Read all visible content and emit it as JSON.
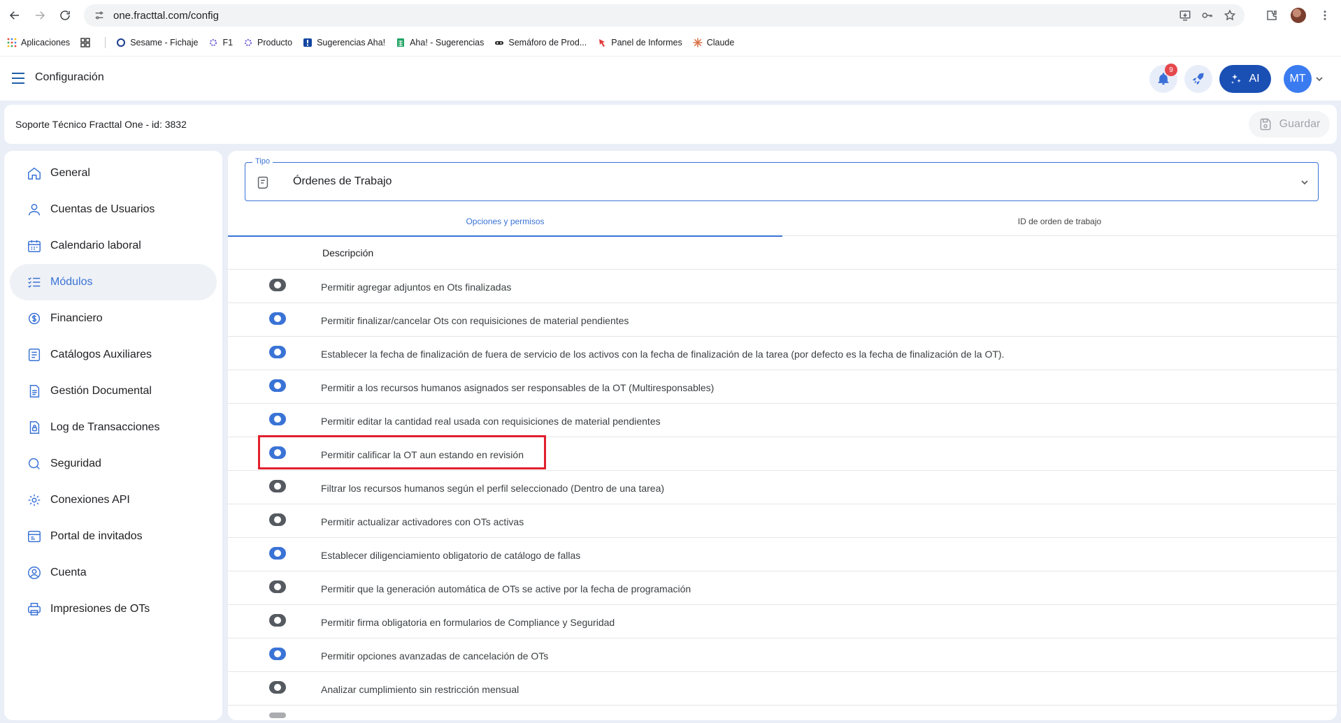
{
  "browser": {
    "url": "one.fracttal.com/config",
    "bookmarks": [
      {
        "label": "Aplicaciones",
        "icon": "apps-grid-icon"
      },
      {
        "label": "",
        "icon": "grid-icon"
      },
      {
        "label": "Sesame - Fichaje",
        "icon": "sesame-icon"
      },
      {
        "label": "F1",
        "icon": "fracttal-icon"
      },
      {
        "label": "Producto",
        "icon": "fracttal-icon"
      },
      {
        "label": "Sugerencias Aha!",
        "icon": "aha-icon"
      },
      {
        "label": "Aha! - Sugerencias",
        "icon": "sheets-icon"
      },
      {
        "label": "Semáforo de Prod...",
        "icon": "glasses-icon"
      },
      {
        "label": "Panel de Informes",
        "icon": "pin-icon"
      },
      {
        "label": "Claude",
        "icon": "claude-icon"
      }
    ]
  },
  "header": {
    "title": "Configuración",
    "notification_count": "9",
    "ai_label": "AI",
    "avatar_initials": "MT"
  },
  "company": {
    "name": "Soporte Técnico Fracttal One - id: 3832",
    "save_label": "Guardar"
  },
  "sidebar": {
    "items": [
      {
        "label": "General",
        "icon": "home-icon",
        "active": false
      },
      {
        "label": "Cuentas de Usuarios",
        "icon": "user-icon",
        "active": false
      },
      {
        "label": "Calendario laboral",
        "icon": "calendar-icon",
        "active": false
      },
      {
        "label": "Módulos",
        "icon": "checklist-icon",
        "active": true
      },
      {
        "label": "Financiero",
        "icon": "money-icon",
        "active": false
      },
      {
        "label": "Catálogos Auxiliares",
        "icon": "catalog-icon",
        "active": false
      },
      {
        "label": "Gestión Documental",
        "icon": "document-icon",
        "active": false
      },
      {
        "label": "Log de Transacciones",
        "icon": "log-lock-icon",
        "active": false
      },
      {
        "label": "Seguridad",
        "icon": "security-icon",
        "active": false
      },
      {
        "label": "Conexiones API",
        "icon": "api-gear-icon",
        "active": false
      },
      {
        "label": "Portal de invitados",
        "icon": "portal-icon",
        "active": false
      },
      {
        "label": "Cuenta",
        "icon": "account-icon",
        "active": false
      },
      {
        "label": "Impresiones de OTs",
        "icon": "printer-icon",
        "active": false
      }
    ]
  },
  "main": {
    "tipo_label": "Tipo",
    "tipo_value": "Órdenes de Trabajo",
    "tabs": [
      {
        "label": "Opciones y permisos",
        "active": true
      },
      {
        "label": "ID de orden de trabajo",
        "active": false
      }
    ],
    "column_header": "Descripción",
    "options": [
      {
        "label": "Permitir agregar adjuntos en Ots finalizadas",
        "enabled": false
      },
      {
        "label": "Permitir finalizar/cancelar Ots con requisiciones de material pendientes",
        "enabled": true
      },
      {
        "label": "Establecer la fecha de finalización de fuera de servicio de los activos con la fecha de finalización de la tarea (por defecto es la fecha de finalización de la OT).",
        "enabled": true
      },
      {
        "label": "Permitir a los recursos humanos asignados ser responsables de la OT (Multiresponsables)",
        "enabled": true
      },
      {
        "label": "Permitir editar la cantidad real usada con requisiciones de material pendientes",
        "enabled": true
      },
      {
        "label": "Permitir calificar la OT aun estando en revisión",
        "enabled": true,
        "highlighted": true
      },
      {
        "label": "Filtrar los recursos humanos según el perfil seleccionado (Dentro de una tarea)",
        "enabled": false
      },
      {
        "label": "Permitir actualizar activadores con OTs activas",
        "enabled": false
      },
      {
        "label": "Establecer diligenciamiento obligatorio de catálogo de fallas",
        "enabled": true
      },
      {
        "label": "Permitir que la generación automática de OTs se active por la fecha de programación",
        "enabled": false
      },
      {
        "label": "Permitir firma obligatoria en formularios de Compliance y Seguridad",
        "enabled": false
      },
      {
        "label": "Permitir opciones avanzadas de cancelación de OTs",
        "enabled": true
      },
      {
        "label": "Analizar cumplimiento sin restricción mensual",
        "enabled": false
      }
    ]
  },
  "colors": {
    "accent": "#3a73d6",
    "highlight": "#e0202e",
    "toggle_off": "#555a60"
  }
}
